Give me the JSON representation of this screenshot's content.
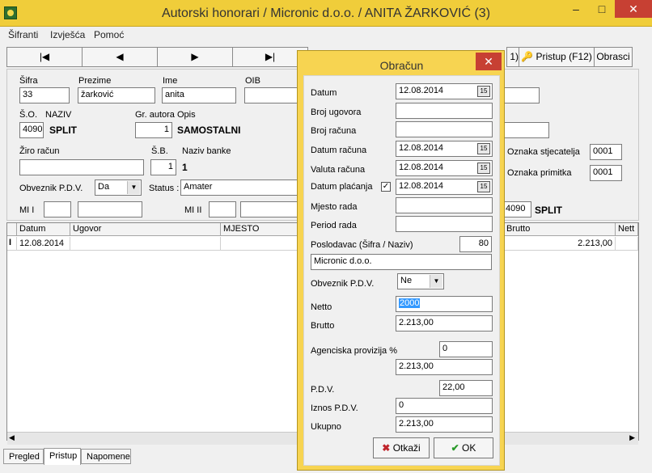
{
  "window": {
    "title": "Autorski honorari / Micronic d.o.o.  / ANITA ŽARKOVIĆ (3)",
    "minimize": "–",
    "maximize": "□",
    "close": "✕"
  },
  "menu": [
    "Šifranti",
    "Izvješća",
    "Pomoć"
  ],
  "nav": {
    "first": "|◀",
    "prev": "◀",
    "next": "▶",
    "last": "▶|",
    "count_fragment": "1)",
    "pristup": "Pristup (F12)",
    "obrasci": "Obrasci"
  },
  "form": {
    "sifra_label": "Šifra",
    "sifra": "33",
    "prezime_label": "Prezime",
    "prezime": "žarković",
    "ime_label": "Ime",
    "ime": "anita",
    "oib_label": "OIB",
    "oib": "",
    "so_label": "Š.O.",
    "naziv_label": "NAZIV",
    "so": "4090",
    "so_naziv": "SPLIT",
    "gr_autora_label": "Gr. autora Opis",
    "gr_autora": "1",
    "gr_autora_opis": "SAMOSTALNI",
    "ziro_label": "Žiro račun",
    "ziro": "",
    "sb_label": "Š.B.",
    "sb": "1",
    "naziv_banke_label": "Naziv banke",
    "naziv_banke": "1",
    "obveznik_pdv_label": "Obveznik P.D.V.",
    "obveznik_pdv": "Da",
    "status_label": "Status :",
    "status": "Amater",
    "mi1_label": "MI I",
    "mi2_label": "MI II",
    "oznaka_stjecatelja_label": "Oznaka stjecatelja",
    "oznaka_stjecatelja": "0001",
    "oznaka_primitka_label": "Oznaka primitka",
    "oznaka_primitka": "0001",
    "right_so": "4090",
    "right_so_naziv": "SPLIT"
  },
  "grid": {
    "columns": [
      "Datum",
      "Ugovor",
      "MJESTO",
      "Brutto",
      "Nett"
    ],
    "rows": [
      {
        "marker": "I",
        "datum": "12.08.2014",
        "brutto": "2.213,00"
      }
    ]
  },
  "tabs": [
    "Pregled",
    "Pristup",
    "Napomene"
  ],
  "dialog": {
    "title": "Obračun",
    "datum_label": "Datum",
    "datum": "12.08.2014",
    "broj_ugovora_label": "Broj ugovora",
    "broj_ugovora": "",
    "broj_racuna_label": "Broj računa",
    "broj_racuna": "",
    "datum_racuna_label": "Datum računa",
    "datum_racuna": "12.08.2014",
    "valuta_racuna_label": "Valuta računa",
    "valuta_racuna": "12.08.2014",
    "datum_placanja_label": "Datum plaćanja",
    "datum_placanja": "12.08.2014",
    "datum_placanja_checked": "✓",
    "mjesto_rada_label": "Mjesto rada",
    "mjesto_rada": "",
    "period_rada_label": "Period rada",
    "period_rada": "",
    "poslodavac_label": "Poslodavac (Šifra / Naziv)",
    "poslodavac_sifra": "80",
    "poslodavac_naziv": "Micronic d.o.o.",
    "obveznik_pdv_label": "Obveznik P.D.V.",
    "obveznik_pdv": "Ne",
    "netto_label": "Netto",
    "netto": "2000",
    "brutto_label": "Brutto",
    "brutto": "2.213,00",
    "agencijska_label": "Agenciska provizija %",
    "agencijska_pct": "0",
    "agencijska_iznos": "2.213,00",
    "pdv_label": "P.D.V.",
    "pdv": "22,00",
    "iznos_pdv_label": "Iznos P.D.V.",
    "iznos_pdv": "0",
    "ukupno_label": "Ukupno",
    "ukupno": "2.213,00",
    "cancel_label": "Otkaži",
    "ok_label": "OK",
    "calendar_glyph": "15"
  }
}
